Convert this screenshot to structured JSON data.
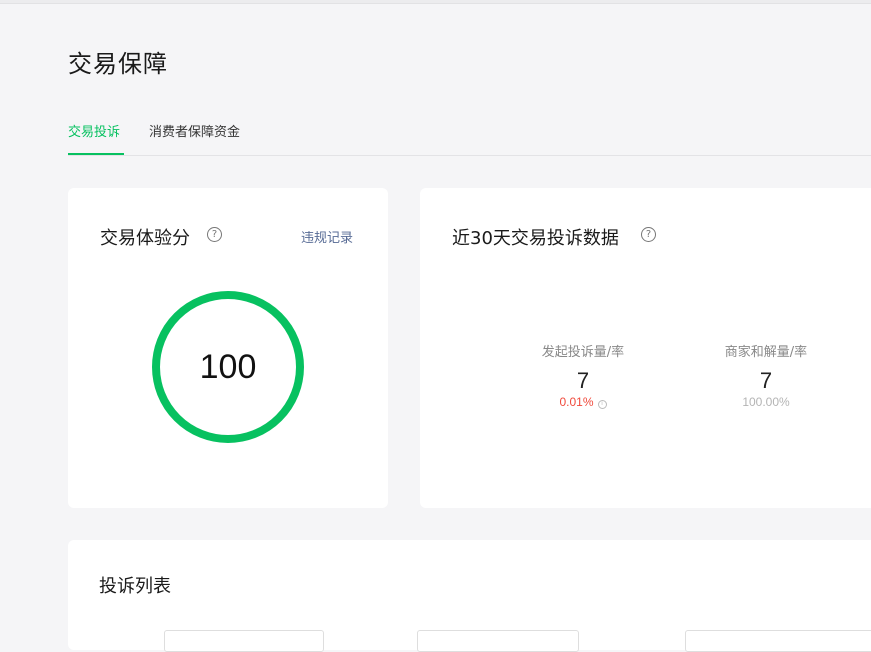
{
  "page": {
    "title": "交易保障"
  },
  "tabs": [
    {
      "label": "交易投诉",
      "active": true
    },
    {
      "label": "消费者保障资金",
      "active": false
    }
  ],
  "score_card": {
    "title": "交易体验分",
    "help_icon": "question-circle-icon",
    "link_label": "违规记录",
    "score": "100",
    "ring_color": "#07c160"
  },
  "complaint_card": {
    "title": "近30天交易投诉数据",
    "help_icon": "question-circle-icon",
    "stats": [
      {
        "label": "发起投诉量/率",
        "value": "7",
        "rate": "0.01%",
        "rate_color": "#f04a3c",
        "has_info": true
      },
      {
        "label": "商家和解量/率",
        "value": "7",
        "rate": "100.00%",
        "rate_color": "#b4b4b4",
        "has_info": false
      }
    ]
  },
  "list_card": {
    "title": "投诉列表"
  },
  "colors": {
    "accent": "#07c160",
    "link": "#576b95",
    "background": "#f5f5f7"
  }
}
